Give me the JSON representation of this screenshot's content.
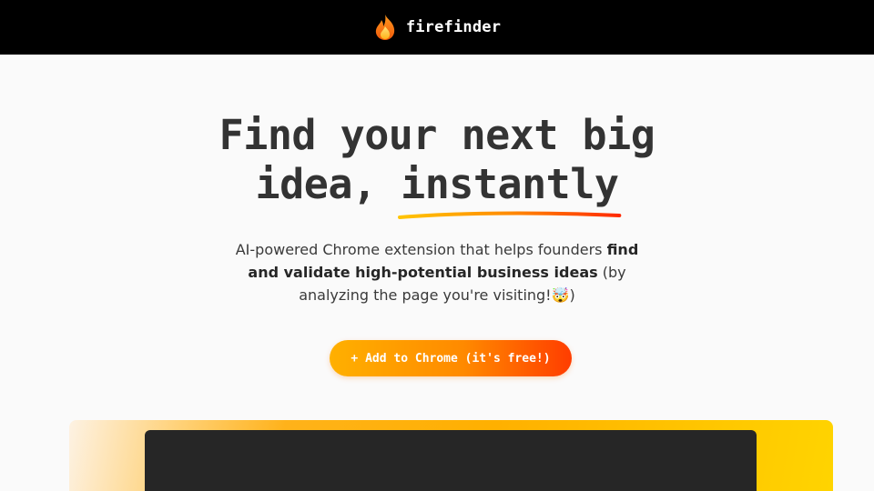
{
  "header": {
    "brand_name": "firefinder",
    "brand_icon": "flame-icon"
  },
  "hero": {
    "title_line1": "Find your next big",
    "title_line2_prefix": "idea, ",
    "title_highlight": "instantly",
    "subtitle_part1": "AI-powered Chrome extension that helps founders ",
    "subtitle_bold": "find and validate high-potential business ideas",
    "subtitle_part2": " (by analyzing the page you're visiting!🤯)"
  },
  "cta": {
    "label": "+ Add to Chrome (it's free!)"
  },
  "colors": {
    "header_bg": "#000000",
    "page_bg": "#fafafa",
    "cta_start": "#ffb000",
    "cta_end": "#ff3d00",
    "underline_start": "#ffc400",
    "underline_end": "#ff2a00",
    "showcase_frame": "#262626"
  }
}
